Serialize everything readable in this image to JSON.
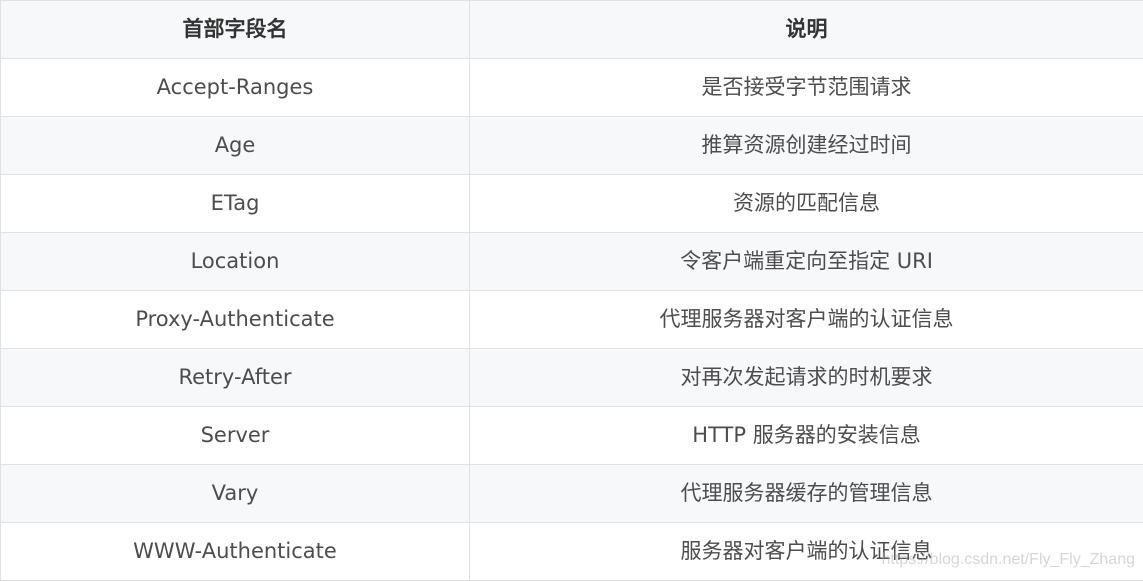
{
  "table": {
    "headers": [
      "首部字段名",
      "说明"
    ],
    "rows": [
      {
        "field": "Accept-Ranges",
        "desc": "是否接受字节范围请求"
      },
      {
        "field": "Age",
        "desc": "推算资源创建经过时间"
      },
      {
        "field": "ETag",
        "desc": "资源的匹配信息"
      },
      {
        "field": "Location",
        "desc": "令客户端重定向至指定 URI"
      },
      {
        "field": "Proxy-Authenticate",
        "desc": "代理服务器对客户端的认证信息"
      },
      {
        "field": "Retry-After",
        "desc": "对再次发起请求的时机要求"
      },
      {
        "field": "Server",
        "desc": "HTTP 服务器的安装信息"
      },
      {
        "field": "Vary",
        "desc": "代理服务器缓存的管理信息"
      },
      {
        "field": "WWW-Authenticate",
        "desc": "服务器对客户端的认证信息"
      }
    ]
  },
  "watermark": "https://blog.csdn.net/Fly_Fly_Zhang",
  "colors": {
    "border": "#dfe2e5",
    "stripe": "#f6f8fa",
    "text": "#4d4d4d"
  }
}
